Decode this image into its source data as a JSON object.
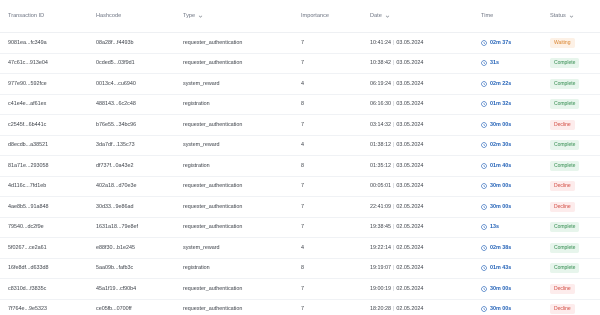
{
  "header": {
    "transaction_id": "Transaction ID",
    "hashcode": "Hashcode",
    "type": "Type",
    "importance": "Importance",
    "date": "Date",
    "time": "Time",
    "status": "Status"
  },
  "status_colors": {
    "Complete": "#2f8a4c",
    "Decline": "#d0453b",
    "Waiting": "#d9822b"
  },
  "rows": [
    {
      "tx": "9081ea...fc349a",
      "hash": "08a28f...f4493b",
      "type": "requester_authentication",
      "imp": "7",
      "time_of_day": "10:41:24",
      "date": "03.05.2024",
      "elapsed": "02m 37s",
      "status": "Waiting",
      "status_key": "waiting"
    },
    {
      "tx": "47c61c...913e04",
      "hash": "0cded5...03f9d1",
      "type": "requester_authentication",
      "imp": "7",
      "time_of_day": "10:38:42",
      "date": "03.05.2024",
      "elapsed": "31s",
      "status": "Complete",
      "status_key": "complete"
    },
    {
      "tx": "977e90...592fce",
      "hash": "0013c4...cu6940",
      "type": "system_reward",
      "imp": "4",
      "time_of_day": "06:19:24",
      "date": "03.05.2024",
      "elapsed": "02m 22s",
      "status": "Complete",
      "status_key": "complete"
    },
    {
      "tx": "c41e4e...af61ex",
      "hash": "488143...6c2c48",
      "type": "registration",
      "imp": "8",
      "time_of_day": "06:16:30",
      "date": "03.05.2024",
      "elapsed": "01m 32s",
      "status": "Complete",
      "status_key": "complete"
    },
    {
      "tx": "c2545f...6b441c",
      "hash": "b76e55...34bc96",
      "type": "requester_authentication",
      "imp": "7",
      "time_of_day": "03:14:32",
      "date": "03.05.2024",
      "elapsed": "30m 00s",
      "status": "Decline",
      "status_key": "decline"
    },
    {
      "tx": "d8ecdb...a38521",
      "hash": "3da7df...135c73",
      "type": "system_reward",
      "imp": "4",
      "time_of_day": "01:38:12",
      "date": "03.05.2024",
      "elapsed": "02m 30s",
      "status": "Complete",
      "status_key": "complete"
    },
    {
      "tx": "81a71e...293058",
      "hash": "df737f...0a43e2",
      "type": "registration",
      "imp": "8",
      "time_of_day": "01:35:12",
      "date": "03.05.2024",
      "elapsed": "01m 40s",
      "status": "Complete",
      "status_key": "complete"
    },
    {
      "tx": "4d116c...7fd1eb",
      "hash": "402a18...d70e3e",
      "type": "requester_authentication",
      "imp": "7",
      "time_of_day": "00:05:01",
      "date": "03.05.2024",
      "elapsed": "30m 00s",
      "status": "Decline",
      "status_key": "decline"
    },
    {
      "tx": "4ae8b5...91a848",
      "hash": "30d33...9e86ad",
      "type": "requester_authentication",
      "imp": "7",
      "time_of_day": "22:41:09",
      "date": "02.05.2024",
      "elapsed": "30m 00s",
      "status": "Decline",
      "status_key": "decline"
    },
    {
      "tx": "79540...dc2f9e",
      "hash": "1631a18...79e8ef",
      "type": "requester_authentication",
      "imp": "7",
      "time_of_day": "19:38:45",
      "date": "02.05.2024",
      "elapsed": "13s",
      "status": "Complete",
      "status_key": "complete"
    },
    {
      "tx": "5f0267...ce2a61",
      "hash": "e88f30...b1e245",
      "type": "system_reward",
      "imp": "4",
      "time_of_day": "19:22:14",
      "date": "02.05.2024",
      "elapsed": "02m 38s",
      "status": "Complete",
      "status_key": "complete"
    },
    {
      "tx": "16fe8df...d633d8",
      "hash": "5aa09b...fafb3c",
      "type": "registration",
      "imp": "8",
      "time_of_day": "19:19:07",
      "date": "02.05.2024",
      "elapsed": "01m 43s",
      "status": "Complete",
      "status_key": "complete"
    },
    {
      "tx": "c8310d...f3835c",
      "hash": "45a1f19...cf90b4",
      "type": "requester_authentication",
      "imp": "7",
      "time_of_day": "19:00:19",
      "date": "02.05.2024",
      "elapsed": "30m 00s",
      "status": "Decline",
      "status_key": "decline"
    },
    {
      "tx": "7f764e...9e5323",
      "hash": "ce05fb...0700ff",
      "type": "requester_authentication",
      "imp": "7",
      "time_of_day": "18:20:28",
      "date": "02.05.2024",
      "elapsed": "30m 00s",
      "status": "Decline",
      "status_key": "decline"
    }
  ]
}
